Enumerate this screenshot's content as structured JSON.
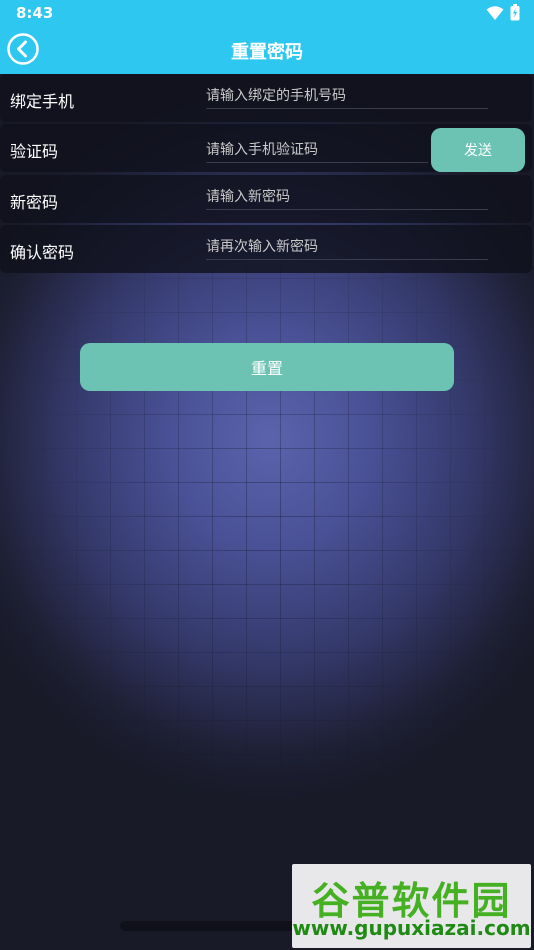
{
  "status_bar": {
    "time": "8:43",
    "icons": [
      "wifi-icon",
      "battery-icon"
    ]
  },
  "header": {
    "title": "重置密码",
    "back_icon": "back-arrow-icon"
  },
  "form": {
    "rows": [
      {
        "label": "绑定手机",
        "placeholder": "请输入绑定的手机号码",
        "value": ""
      },
      {
        "label": "验证码",
        "placeholder": "请输入手机验证码",
        "value": "",
        "action_label": "发送"
      },
      {
        "label": "新密码",
        "placeholder": "请输入新密码",
        "value": ""
      },
      {
        "label": "确认密码",
        "placeholder": "请再次输入新密码",
        "value": ""
      }
    ]
  },
  "reset_button": {
    "label": "重置"
  },
  "watermark": {
    "title": "谷普软件园",
    "url": "www.gupuxiazai.com"
  },
  "colors": {
    "header_bg": "#2ec7f0",
    "button_bg": "#6cc3b4",
    "row_bg": "#10111c",
    "background_center": "#5a63ac",
    "background_edge": "#181a28"
  }
}
